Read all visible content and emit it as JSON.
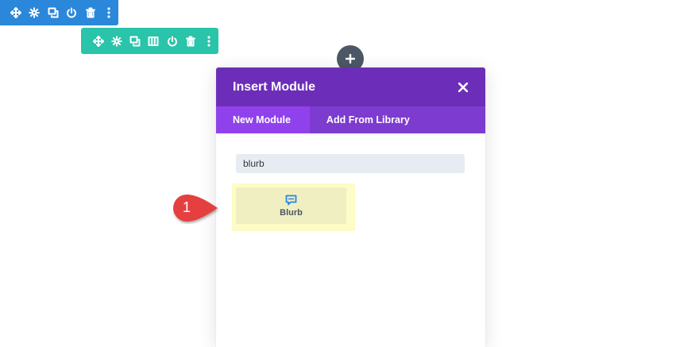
{
  "colors": {
    "section_toolbar": "#2b87da",
    "row_toolbar": "#29c4a9",
    "modal_header": "#6c2eb9",
    "modal_tabs": "#7d3bcf",
    "active_tab": "#8f42ec",
    "step_marker": "#e53f3f",
    "highlight": "#fdfcc6"
  },
  "section_toolbar": {
    "icons": [
      "move-icon",
      "gear-icon",
      "duplicate-icon",
      "power-icon",
      "trash-icon",
      "more-icon"
    ]
  },
  "row_toolbar": {
    "icons": [
      "move-icon",
      "gear-icon",
      "duplicate-icon",
      "columns-icon",
      "power-icon",
      "trash-icon",
      "more-icon"
    ]
  },
  "add_module": {
    "icon": "plus-icon"
  },
  "modal": {
    "title": "Insert Module",
    "close_icon": "close-icon",
    "tabs": [
      {
        "label": "New Module",
        "active": true
      },
      {
        "label": "Add From Library",
        "active": false
      }
    ],
    "search": {
      "value": "blurb"
    },
    "results": [
      {
        "label": "Blurb",
        "icon": "blurb-icon"
      }
    ]
  },
  "step_marker": {
    "number": "1"
  }
}
